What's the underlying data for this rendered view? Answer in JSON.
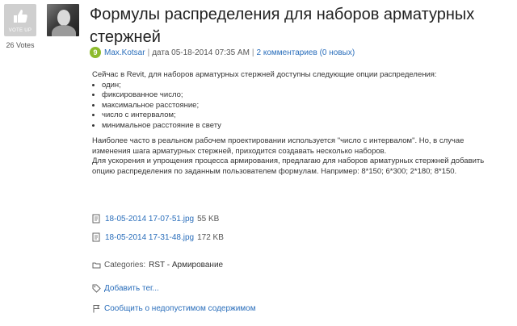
{
  "vote": {
    "label": "VOTE UP",
    "count": "26 Votes"
  },
  "title": "Формулы распределения для наборов арматурных стержней",
  "meta": {
    "badge": "9",
    "author": "Max.Kotsar",
    "separator": "|",
    "date": "дата 05-18-2014 07:35 AM",
    "comments": "2 комментариев (0 новых)"
  },
  "content": {
    "intro": "Сейчас в Revit, для наборов арматурных стержней доступны следующие опции распределения:",
    "options": [
      "один;",
      "фиксированное число;",
      "максимальное расстояние;",
      "число с интервалом;",
      "минимальное расстояние в свету"
    ],
    "para2": "Наиболее часто в реальном рабочем проектировании используется \"число с интервалом\". Но, в случае изменения шага арматурных стержней, приходится создавать несколько наборов.",
    "para3": "Для ускорения и упрощения процесса армирования, предлагаю для наборов арматурных стержней добавить опцию распределения по заданным пользователем формулам. Например: 8*150; 6*300; 2*180; 8*150."
  },
  "attachments": [
    {
      "name": "18-05-2014 17-07-51.jpg",
      "size": "55 KB"
    },
    {
      "name": "18-05-2014 17-31-48.jpg",
      "size": "172 KB"
    }
  ],
  "categories": {
    "label": "Categories:",
    "value": "RST - Армирование"
  },
  "add_tag": "Добавить тег...",
  "report": "Сообщить о недопустимом содержимом"
}
